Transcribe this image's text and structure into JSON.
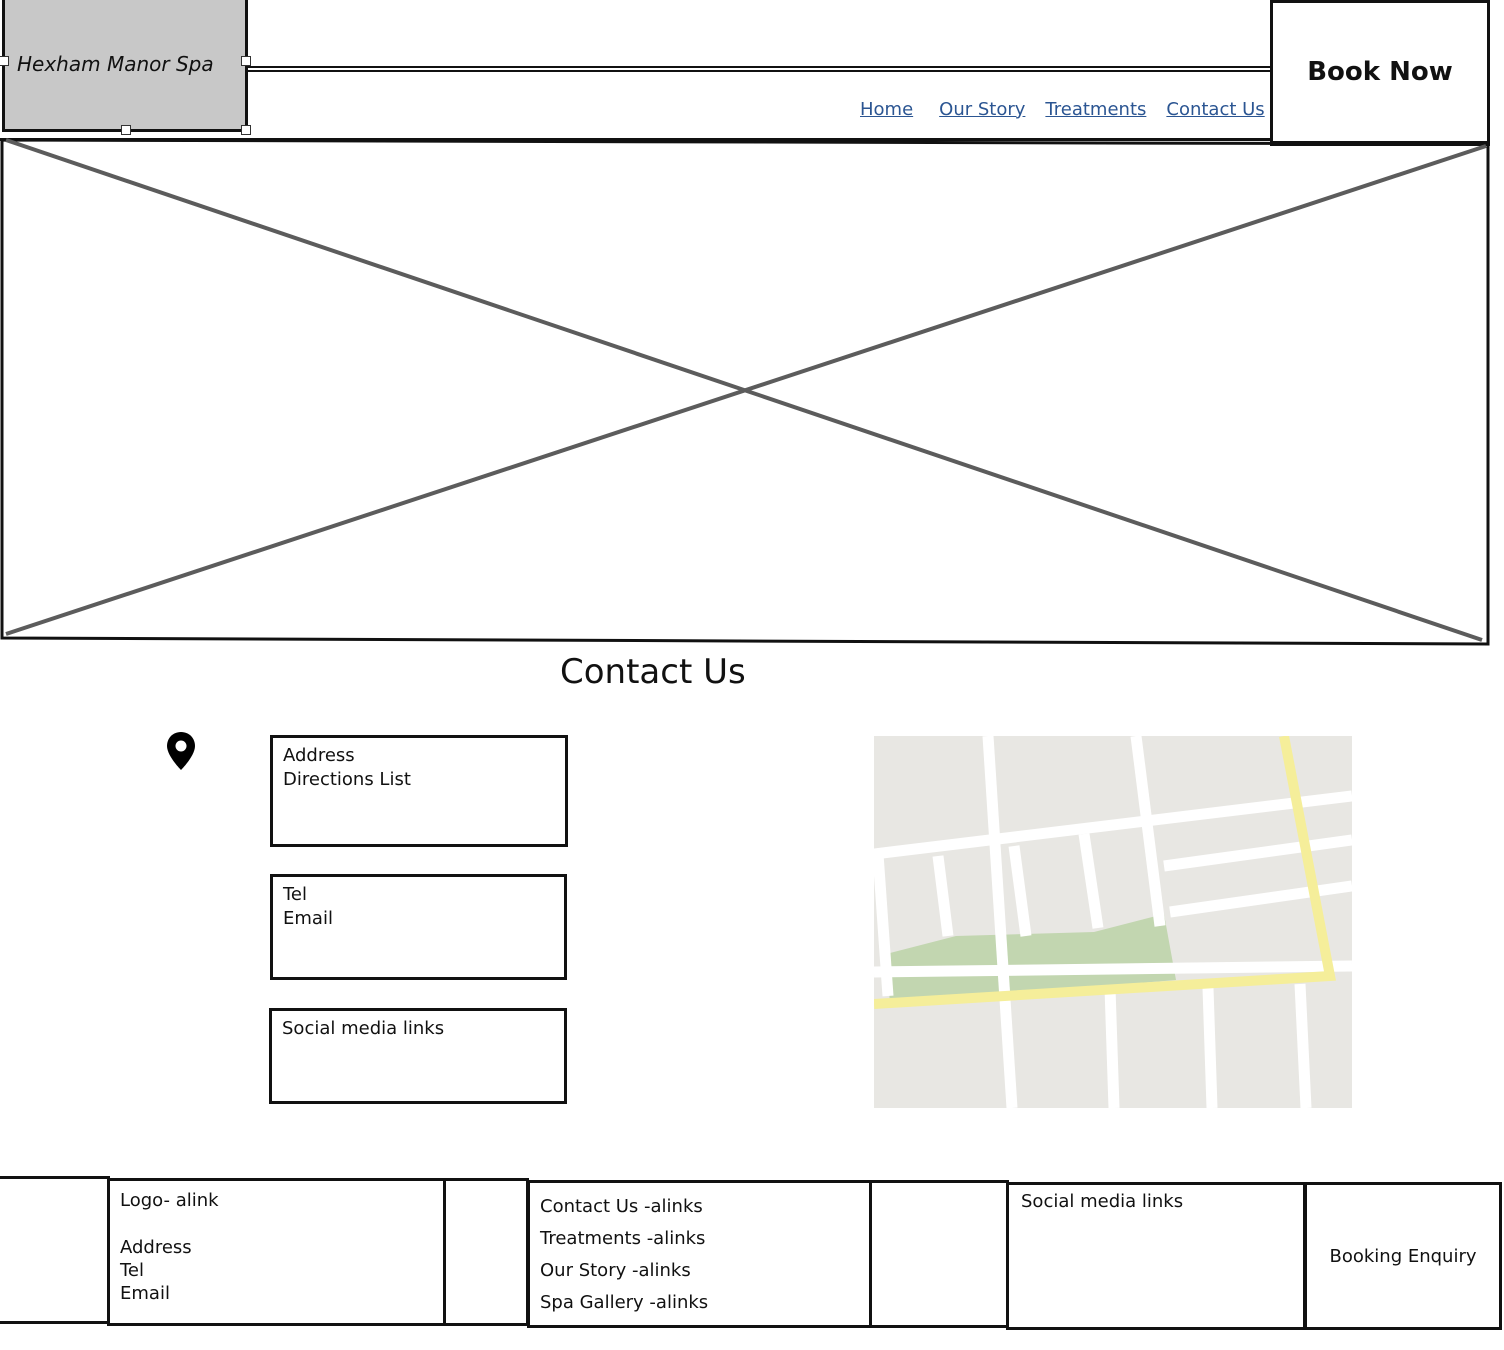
{
  "header": {
    "logo_text": "Hexham Manor Spa",
    "nav": {
      "home": "Home",
      "our_story": "Our Story",
      "treatments": "Treatments",
      "contact_us": "Contact Us"
    },
    "book_now": "Book Now"
  },
  "main": {
    "title": "Contact Us",
    "address_box": {
      "line1": "Address",
      "line2": "Directions List"
    },
    "contact_box": {
      "line1": "Tel",
      "line2": "Email"
    },
    "social_box": {
      "line1": "Social media links"
    }
  },
  "footer": {
    "logo_col": {
      "logo": "Logo- alink",
      "address": "Address",
      "tel": "Tel",
      "email": "Email"
    },
    "links_col": {
      "contact": "Contact Us -alinks",
      "treatments": "Treatments -alinks",
      "story": "Our Story -alinks",
      "gallery": "Spa Gallery -alinks"
    },
    "social": "Social media links",
    "booking": "Booking Enquiry"
  },
  "colors": {
    "nav_link": "#2b5592",
    "logo_bg": "#c8c8c8",
    "map_bg": "#e8e7e3",
    "map_park": "#c2d6b0",
    "map_road_major": "#f5ee9a"
  },
  "icons": [
    "map-pin-icon"
  ]
}
